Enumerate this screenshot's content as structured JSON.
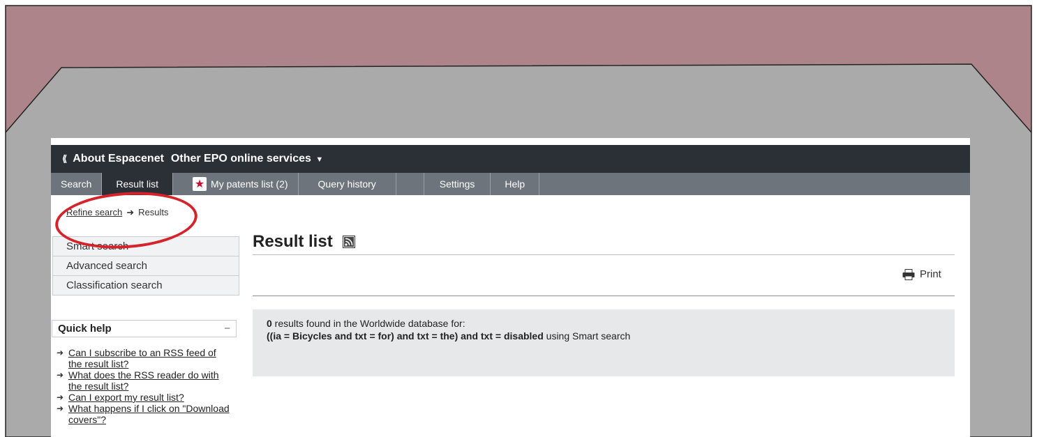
{
  "colors": {
    "frame_top": "#ad848a",
    "frame_gray": "#a9aaa9",
    "topbar": "#2b3037",
    "tabbar": "#6e747b",
    "highlight": "#d4232b",
    "star": "#c8102e"
  },
  "topbar": {
    "back_icon": "double-chevron-left-icon",
    "about": "About Espacenet",
    "other": "Other EPO online services"
  },
  "tabs": [
    {
      "label": "Search"
    },
    {
      "label": "Result list"
    },
    {
      "label": "My patents list (2)",
      "icon": "star-icon"
    },
    {
      "label": "Query history"
    },
    {
      "label": ""
    },
    {
      "label": "Settings"
    },
    {
      "label": "Help"
    }
  ],
  "breadcrumb": {
    "link": "Refine search",
    "current": "Results"
  },
  "search_nav": [
    {
      "label": "Smart search"
    },
    {
      "label": "Advanced search"
    },
    {
      "label": "Classification search"
    }
  ],
  "quick_help": {
    "title": "Quick help",
    "toggle": "−",
    "items": [
      {
        "label": "Can I subscribe to an RSS feed of the result list?"
      },
      {
        "label": "What does the RSS reader do with the result list?"
      },
      {
        "label": "Can I export my result list?"
      },
      {
        "label": "What happens if I click on \"Download covers\"?"
      }
    ]
  },
  "main": {
    "title": "Result list",
    "print_label": "Print",
    "results": {
      "count": "0",
      "line1_rest": " results found in the Worldwide database for:",
      "query": "((ia = Bicycles and txt = for) and txt = the) and txt = disabled",
      "using": " using Smart search"
    }
  }
}
